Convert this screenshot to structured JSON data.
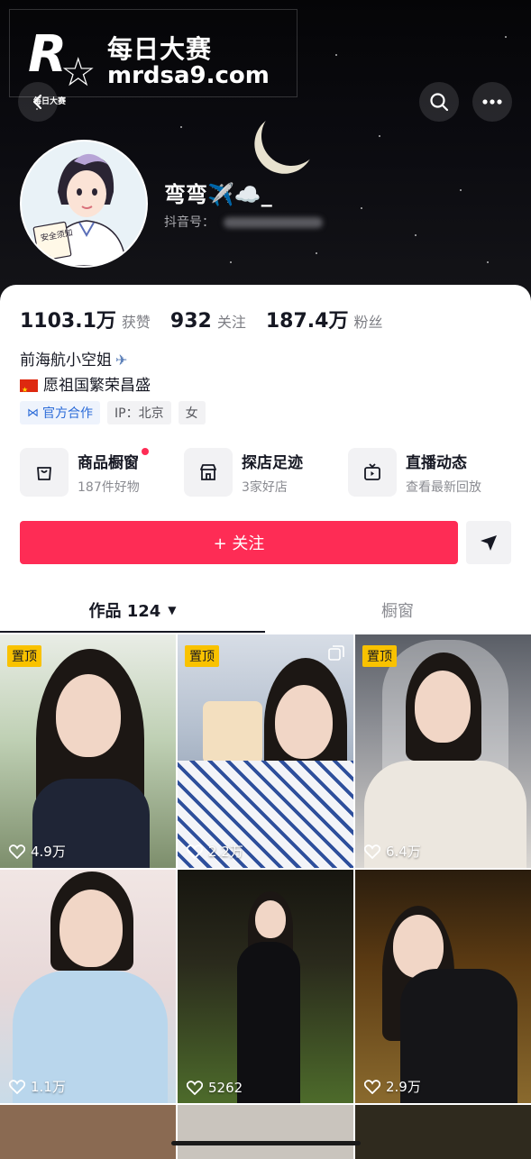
{
  "watermark": {
    "logo_letter": "R",
    "logo_sub": "每日大赛",
    "title": "每日大赛",
    "url": "mrdsa9.com"
  },
  "header": {
    "back_icon": "chevron-left-icon",
    "search_icon": "search-icon",
    "more_icon": "more-horizontal-icon"
  },
  "profile": {
    "nickname": "弯弯✈️☁️_",
    "douyin_id_label": "抖音号："
  },
  "stats": [
    {
      "value": "1103.1万",
      "label": "获赞"
    },
    {
      "value": "932",
      "label": "关注"
    },
    {
      "value": "187.4万",
      "label": "粉丝"
    }
  ],
  "bio": {
    "line1": "前海航小空姐",
    "line2": "愿祖国繁荣昌盛"
  },
  "tags": [
    {
      "label": "官方合作",
      "icon": "official-icon"
    },
    {
      "label": "IP：北京"
    },
    {
      "label": "女"
    }
  ],
  "services": [
    {
      "title": "商品橱窗",
      "sub": "187件好物",
      "icon": "shopping-bag-icon",
      "badge": true
    },
    {
      "title": "探店足迹",
      "sub": "3家好店",
      "icon": "store-icon",
      "badge": false
    },
    {
      "title": "直播动态",
      "sub": "查看最新回放",
      "icon": "tv-icon",
      "badge": false
    }
  ],
  "actions": {
    "follow_label": "+ 关注",
    "send_icon": "send-icon"
  },
  "tabs": [
    {
      "label": "作品 124",
      "active": true
    },
    {
      "label": "橱窗",
      "active": false
    }
  ],
  "videos": [
    {
      "likes": "4.9万",
      "pinned": true,
      "pin_label": "置顶",
      "multi": false
    },
    {
      "likes": "2.2万",
      "pinned": true,
      "pin_label": "置顶",
      "multi": true
    },
    {
      "likes": "6.4万",
      "pinned": true,
      "pin_label": "置顶",
      "multi": false
    },
    {
      "likes": "1.1万",
      "pinned": false,
      "multi": false
    },
    {
      "likes": "5262",
      "pinned": false,
      "multi": false
    },
    {
      "likes": "2.9万",
      "pinned": false,
      "multi": false
    }
  ],
  "colors": {
    "accent": "#fe2c55",
    "pin": "#f9c200",
    "official": "#2b6bd8"
  }
}
